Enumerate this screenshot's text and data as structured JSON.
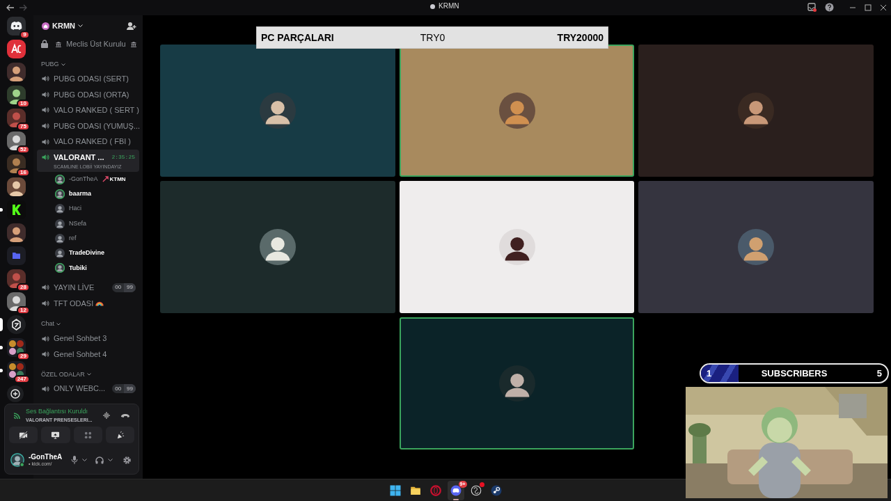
{
  "window": {
    "title": "KRMN"
  },
  "servers": [
    {
      "kind": "home",
      "badge": "9",
      "selected": false,
      "unread": false
    },
    {
      "kind": "logo",
      "selected": false,
      "unread": false
    },
    {
      "kind": "avatar",
      "selected": false,
      "unread": false
    },
    {
      "kind": "avatar",
      "badge": "10",
      "selected": false,
      "unread": false
    },
    {
      "kind": "avatar",
      "badge": "75",
      "selected": false,
      "unread": false
    },
    {
      "kind": "avatar",
      "badge": "52",
      "selected": false,
      "unread": false
    },
    {
      "kind": "avatar",
      "badge": "16",
      "selected": false,
      "unread": false
    },
    {
      "kind": "avatar",
      "selected": false,
      "unread": false
    },
    {
      "kind": "logo",
      "selected": false,
      "unread": true
    },
    {
      "kind": "avatar",
      "selected": false,
      "unread": false
    },
    {
      "kind": "folder",
      "selected": false,
      "unread": false
    },
    {
      "kind": "avatar",
      "badge": "28",
      "selected": false,
      "unread": false
    },
    {
      "kind": "avatar",
      "badge": "12",
      "selected": false,
      "unread": false
    },
    {
      "kind": "logo",
      "selected": true,
      "unread": false
    },
    {
      "kind": "group",
      "badge": "29",
      "selected": false,
      "unread": true
    },
    {
      "kind": "group",
      "badge": "247",
      "selected": false,
      "unread": true
    },
    {
      "kind": "add",
      "selected": false,
      "unread": false
    }
  ],
  "server_header": {
    "name": "KRMN"
  },
  "pinned_channel": {
    "name": "Meclis Üst Kurulu",
    "locked": true,
    "decorated": true
  },
  "categories": [
    {
      "name": "PUBG",
      "channels": [
        {
          "name": "PUBG ODASI (SERT)",
          "connected": false
        },
        {
          "name": "PUBG ODASI (ORTA)",
          "connected": false
        },
        {
          "name": "VALO RANKED ( SERT )",
          "connected": false
        },
        {
          "name": "PUBG ODASI (YUMUŞ...",
          "connected": false
        },
        {
          "name": "VALO RANKED ( FBI )",
          "connected": false
        },
        {
          "name": "VALORANT ...",
          "connected": true,
          "timer": "2:35:25",
          "status": "SCAMLINE LOBİİ YAYINDAYIZ",
          "members": [
            {
              "name": "-GonTheA",
              "tag": "KTMN",
              "speaking": true,
              "active": false
            },
            {
              "name": "baarma",
              "speaking": true,
              "active": true
            },
            {
              "name": "Haci",
              "speaking": false,
              "active": false
            },
            {
              "name": "NSefa",
              "speaking": false,
              "active": false
            },
            {
              "name": "ref",
              "speaking": false,
              "active": false
            },
            {
              "name": "TradeDivine",
              "speaking": false,
              "active": true
            },
            {
              "name": "Tubiki",
              "speaking": true,
              "active": true
            }
          ]
        },
        {
          "name": "YAYIN LİVE",
          "connected": false,
          "counts": [
            "00",
            "99"
          ]
        },
        {
          "name": "TFT ODASI",
          "connected": false,
          "rainbow": true
        }
      ]
    },
    {
      "name": "Chat",
      "channels": [
        {
          "name": "Genel Sohbet 3",
          "connected": false
        },
        {
          "name": "Genel Sohbet 4",
          "connected": false
        }
      ]
    },
    {
      "name": "ÖZEL ODALAR",
      "channels": [
        {
          "name": "ONLY WEBC...",
          "connected": false,
          "counts": [
            "00",
            "99"
          ]
        }
      ]
    }
  ],
  "voice_panel": {
    "status": "Ses Bağlantısı Kuruldı",
    "channel": "VALORANT PRENSESLERI..."
  },
  "user_panel": {
    "name": "-GonTheA",
    "status": "• kick.com/"
  },
  "tiles": [
    {
      "color": "#173b45",
      "speaking": false
    },
    {
      "color": "#a88a5e",
      "speaking": true
    },
    {
      "color": "#2a1f1d",
      "speaking": false
    },
    {
      "color": "#1d2b2b",
      "speaking": false
    },
    {
      "color": "#efeded",
      "speaking": false
    },
    {
      "color": "#35343f",
      "speaking": false
    },
    {
      "color": "#0b2328",
      "speaking": true
    }
  ],
  "goal_bar": {
    "label": "PC PARÇALARI",
    "current": "TRY0",
    "goal": "TRY20000"
  },
  "subscribers": {
    "current": "1",
    "label": "SUBSCRIBERS",
    "goal": "5",
    "level": 0.2
  },
  "taskbar": [
    {
      "kind": "windows",
      "selected": false,
      "alert": false
    },
    {
      "kind": "folder",
      "selected": false,
      "alert": false
    },
    {
      "kind": "opera",
      "selected": false,
      "alert": false
    },
    {
      "kind": "discord",
      "selected": true,
      "alert": false,
      "badge": "9+"
    },
    {
      "kind": "obs",
      "selected": false,
      "alert": true
    },
    {
      "kind": "steam",
      "selected": false,
      "alert": false
    }
  ]
}
